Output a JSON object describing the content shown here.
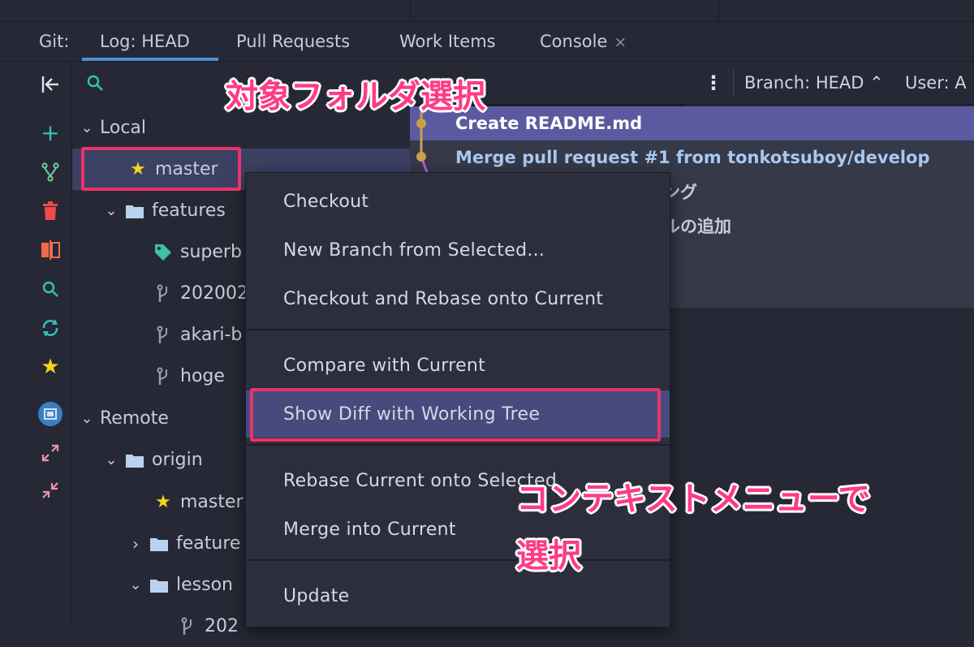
{
  "tabs": {
    "prefix": "Git:",
    "items": [
      "Log: HEAD",
      "Pull Requests",
      "Work Items",
      "Console"
    ],
    "close": "×"
  },
  "log_toolbar": {
    "more": "⋮",
    "branch_filter": "Branch: HEAD ⌃",
    "user_filter": "User: A"
  },
  "tree": {
    "local_label": "Local",
    "local_items": [
      {
        "label": "master",
        "icon": "star-icon"
      },
      {
        "label": "features",
        "icon": "folder-icon"
      },
      {
        "label": "superb",
        "icon": "tag-icon"
      },
      {
        "label": "202002",
        "icon": "branch-icon"
      },
      {
        "label": "akari-b",
        "icon": "branch-icon"
      },
      {
        "label": "hoge",
        "icon": "branch-icon"
      }
    ],
    "remote_label": "Remote",
    "remote_items": [
      {
        "label": "origin",
        "icon": "folder-icon"
      },
      {
        "label": "master",
        "icon": "star-icon"
      },
      {
        "label": "feature",
        "icon": "folder-icon"
      },
      {
        "label": "lesson",
        "icon": "folder-icon"
      },
      {
        "label": "202",
        "icon": "branch-icon"
      }
    ]
  },
  "commits": [
    "Create README.md",
    "Merge pull request #1 from tonkotsuboy/develop",
    "ング",
    "ルの追加"
  ],
  "context_menu": [
    "Checkout",
    "New Branch from Selected...",
    "Checkout and Rebase onto Current",
    "Compare with Current",
    "Show Diff with Working Tree",
    "Rebase Current onto Selected",
    "Merge into Current",
    "Update"
  ],
  "annotations": {
    "folder": "対象フォルダ選択",
    "menu_line1": "コンテキストメニューで",
    "menu_line2": "選択"
  },
  "colors": {
    "accent": "#4f8fd6",
    "highlight": "#e8336b",
    "selected_row": "#3c4163",
    "selected_commit": "#5b5aa0",
    "commit_text": "#a8c8f0"
  }
}
